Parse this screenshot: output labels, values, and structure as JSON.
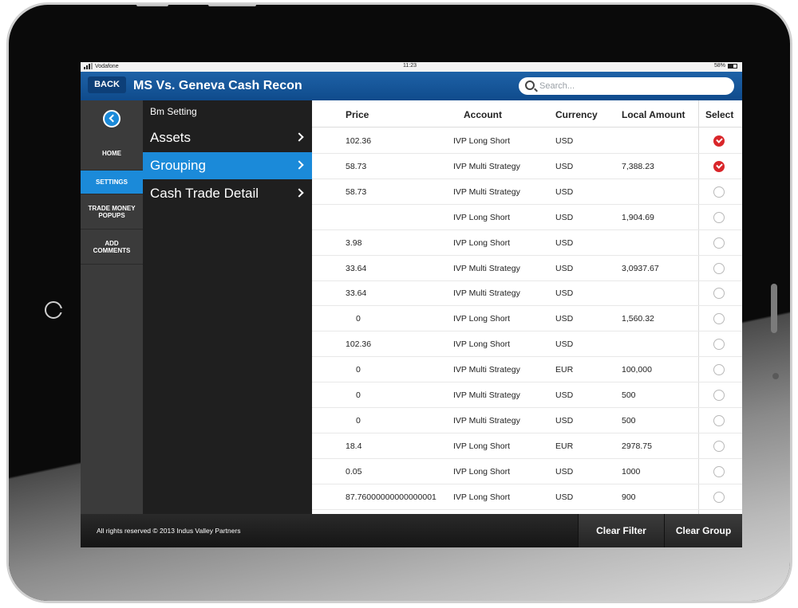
{
  "status_bar": {
    "carrier": "Vodafone",
    "time": "11:23",
    "battery": "58%"
  },
  "header": {
    "back_label": "BACK",
    "title": "MS Vs. Geneva Cash Recon",
    "search_placeholder": "Search..."
  },
  "nav": {
    "items": [
      {
        "label": "HOME"
      },
      {
        "label": "SETTINGS"
      },
      {
        "label": "TRADE MONEY POPUPS"
      },
      {
        "label": "ADD COMMENTS"
      }
    ],
    "active_index": 1
  },
  "sub_menu": {
    "heading": "Bm Setting",
    "items": [
      {
        "label": "Assets"
      },
      {
        "label": "Grouping"
      },
      {
        "label": "Cash Trade Detail"
      }
    ],
    "active_index": 1
  },
  "table": {
    "columns": [
      "Price",
      "Account",
      "Currency",
      "Local Amount",
      "Select"
    ],
    "rows": [
      {
        "price": "102.36",
        "account": "IVP Long Short",
        "currency": "USD",
        "amount": "",
        "selected": true
      },
      {
        "price": "58.73",
        "account": "IVP Multi Strategy",
        "currency": "USD",
        "amount": "7,388.23",
        "selected": true
      },
      {
        "price": "58.73",
        "account": "IVP Multi Strategy",
        "currency": "USD",
        "amount": "",
        "selected": false
      },
      {
        "price": "",
        "account": "IVP Long Short",
        "currency": "USD",
        "amount": "1,904.69",
        "selected": false
      },
      {
        "price": "3.98",
        "account": "IVP Long Short",
        "currency": "USD",
        "amount": "",
        "selected": false
      },
      {
        "price": "33.64",
        "account": "IVP Multi Strategy",
        "currency": "USD",
        "amount": "3,0937.67",
        "selected": false
      },
      {
        "price": "33.64",
        "account": "IVP Multi Strategy",
        "currency": "USD",
        "amount": "",
        "selected": false
      },
      {
        "price": "0",
        "account": "IVP Long Short",
        "currency": "USD",
        "amount": "1,560.32",
        "selected": false
      },
      {
        "price": "102.36",
        "account": "IVP Long Short",
        "currency": "USD",
        "amount": "",
        "selected": false
      },
      {
        "price": "0",
        "account": "IVP Multi Strategy",
        "currency": "EUR",
        "amount": "100,000",
        "selected": false
      },
      {
        "price": "0",
        "account": "IVP Multi Strategy",
        "currency": "USD",
        "amount": "500",
        "selected": false
      },
      {
        "price": "0",
        "account": "IVP Multi Strategy",
        "currency": "USD",
        "amount": "500",
        "selected": false
      },
      {
        "price": "18.4",
        "account": "IVP Long Short",
        "currency": "EUR",
        "amount": "2978.75",
        "selected": false
      },
      {
        "price": "0.05",
        "account": "IVP Long Short",
        "currency": "USD",
        "amount": "1000",
        "selected": false
      },
      {
        "price": "87.76000000000000001",
        "account": "IVP Long Short",
        "currency": "USD",
        "amount": "900",
        "selected": false
      }
    ]
  },
  "footer": {
    "copyright": "All rights reserved © 2013 Indus Valley Partners",
    "clear_filter_label": "Clear Filter",
    "clear_group_label": "Clear Group"
  },
  "colors": {
    "header_blue": "#1e62a7",
    "active_blue": "#1b8ad9",
    "selected_red": "#d9262a"
  }
}
